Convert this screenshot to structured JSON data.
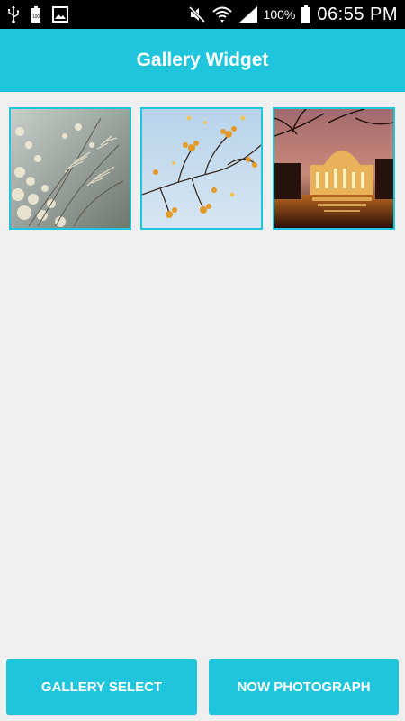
{
  "status_bar": {
    "left_icons": [
      "usb-icon",
      "battery-full-icon",
      "image-icon"
    ],
    "right_icons": [
      "mute-icon",
      "wifi-icon",
      "signal-icon",
      "battery-icon"
    ],
    "battery_percent": "100%",
    "time": "06:55 PM"
  },
  "app_bar": {
    "title": "Gallery Widget",
    "color": "#1ec5dd"
  },
  "gallery": {
    "thumbnails": [
      {
        "name": "frosted-grass-photo"
      },
      {
        "name": "autumn-branch-photo"
      },
      {
        "name": "illuminated-palace-photo"
      }
    ]
  },
  "actions": {
    "gallery_select_label": "GALLERY SELECT",
    "now_photograph_label": "NOW PHOTOGRAPH"
  }
}
